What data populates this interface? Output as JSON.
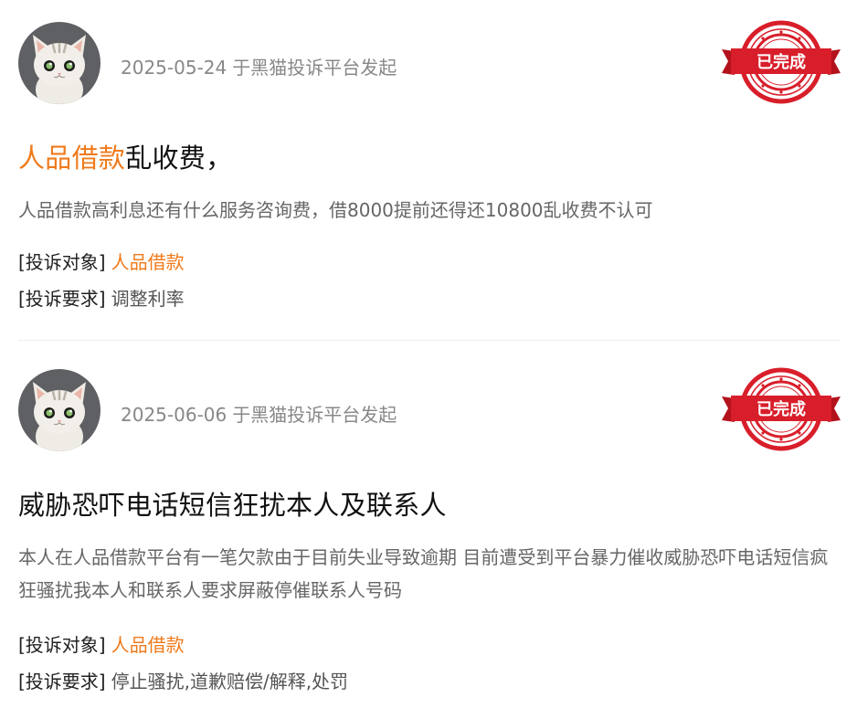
{
  "colors": {
    "accent": "#f07a1b",
    "stamp_red": "#d81e2a",
    "meta_gray": "#888888"
  },
  "complaints": [
    {
      "date": "2025-05-24",
      "source": "于黑猫投诉平台发起",
      "stamp_label": "已完成",
      "title_highlight": "人品借款",
      "title_rest": "乱收费，",
      "description": "人品借款高利息还有什么服务咨询费，借8000提前还得还10800乱收费不认可",
      "target_label": "[投诉对象]",
      "target_value": "人品借款",
      "demand_label": "[投诉要求]",
      "demand_value": "调整利率"
    },
    {
      "date": "2025-06-06",
      "source": "于黑猫投诉平台发起",
      "stamp_label": "已完成",
      "title_highlight": "",
      "title_rest": "威胁恐吓电话短信狂扰本人及联系人",
      "description": "本人在人品借款平台有一笔欠款由于目前失业导致逾期 目前遭受到平台暴力催收威胁恐吓电话短信疯狂骚扰我本人和联系人要求屏蔽停催联系人号码",
      "target_label": "[投诉对象]",
      "target_value": "人品借款",
      "demand_label": "[投诉要求]",
      "demand_value": "停止骚扰,道歉赔偿/解释,处罚"
    }
  ]
}
